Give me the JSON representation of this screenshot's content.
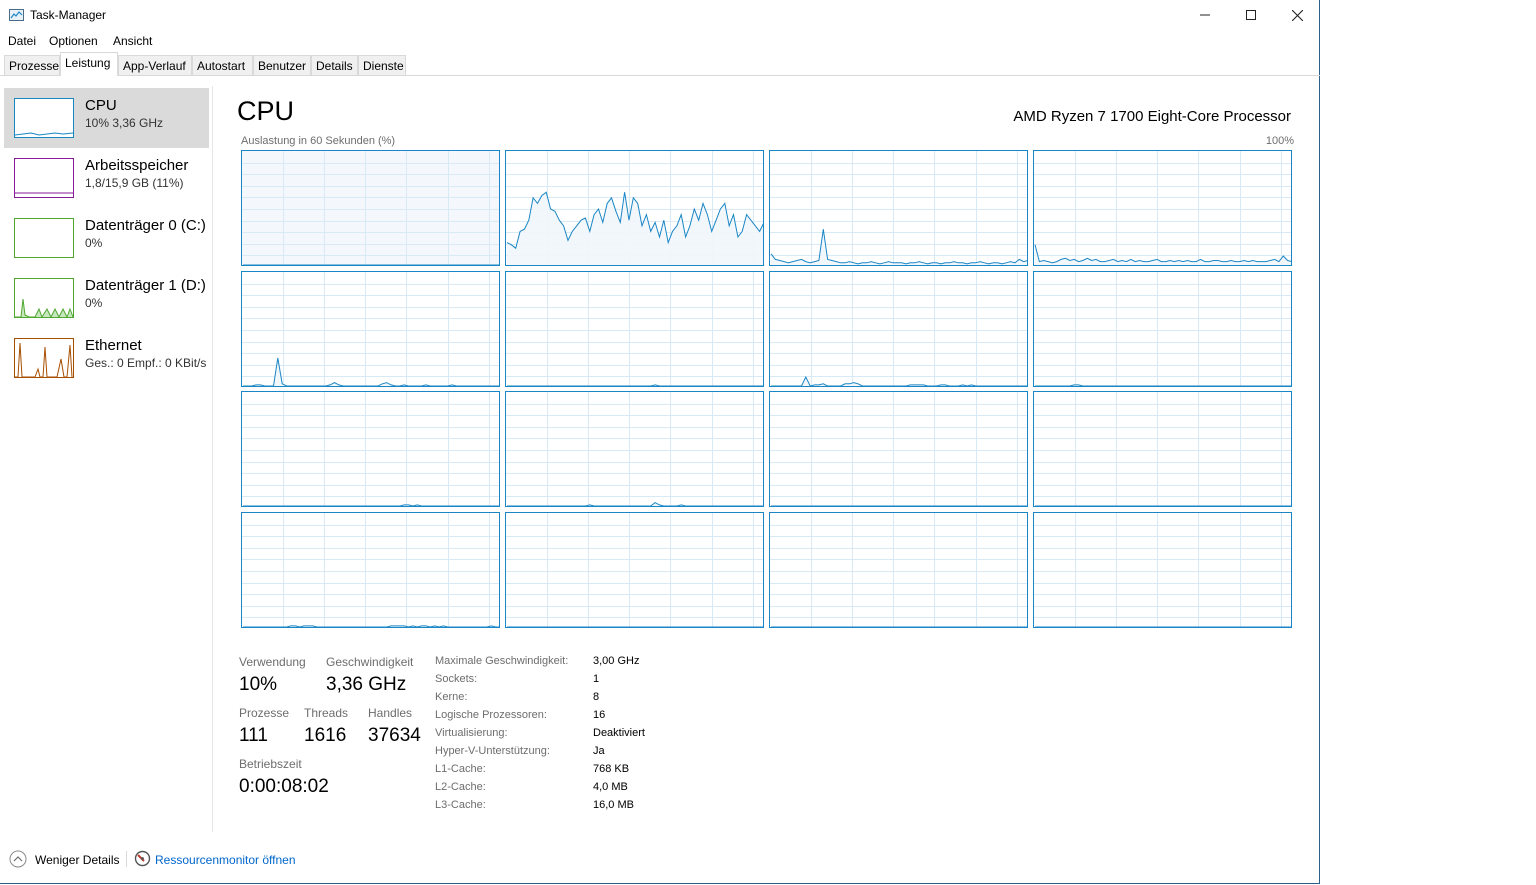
{
  "window": {
    "title": "Task-Manager",
    "controls": [
      "minimize",
      "maximize",
      "close"
    ]
  },
  "menu": [
    "Datei",
    "Optionen",
    "Ansicht"
  ],
  "tabs": [
    "Prozesse",
    "Leistung",
    "App-Verlauf",
    "Autostart",
    "Benutzer",
    "Details",
    "Dienste"
  ],
  "active_tab": "Leistung",
  "sidebar": [
    {
      "title": "CPU",
      "sub": "10%  3,36 GHz",
      "color": "#1a86c5"
    },
    {
      "title": "Arbeitsspeicher",
      "sub": "1,8/15,9 GB (11%)",
      "color": "#8b1a9b"
    },
    {
      "title": "Datenträger 0 (C:)",
      "sub": "0%",
      "color": "#4ea72e"
    },
    {
      "title": "Datenträger 1 (D:)",
      "sub": "0%",
      "color": "#4ea72e"
    },
    {
      "title": "Ethernet",
      "sub": "Ges.: 0  Empf.: 0 KBit/s",
      "color": "#a74f01"
    }
  ],
  "main": {
    "title": "CPU",
    "processor": "AMD Ryzen 7 1700 Eight-Core Processor",
    "graph_label": "Auslastung in 60 Sekunden (%)",
    "graph_max": "100%"
  },
  "stats": {
    "usage_label": "Verwendung",
    "usage": "10%",
    "speed_label": "Geschwindigkeit",
    "speed": "3,36 GHz",
    "processes_label": "Prozesse",
    "processes": "111",
    "threads_label": "Threads",
    "threads": "1616",
    "handles_label": "Handles",
    "handles": "37634",
    "uptime_label": "Betriebszeit",
    "uptime": "0:00:08:02"
  },
  "details": [
    {
      "key": "Maximale Geschwindigkeit:",
      "value": "3,00 GHz"
    },
    {
      "key": "Sockets:",
      "value": "1"
    },
    {
      "key": "Kerne:",
      "value": "8"
    },
    {
      "key": "Logische Prozessoren:",
      "value": "16"
    },
    {
      "key": "Virtualisierung:",
      "value": "Deaktiviert"
    },
    {
      "key": "Hyper-V-Unterstützung:",
      "value": "Ja"
    },
    {
      "key": "L1-Cache:",
      "value": "768 KB"
    },
    {
      "key": "L2-Cache:",
      "value": "4,0 MB"
    },
    {
      "key": "L3-Cache:",
      "value": "16,0 MB"
    }
  ],
  "footer": {
    "fewer_details": "Weniger Details",
    "resource_monitor": "Ressourcenmonitor öffnen"
  },
  "colors": {
    "cpu": "#1a86c5",
    "grid": "#d9eaf7",
    "fill": "#f1f6fb"
  },
  "cores": [
    [
      0,
      0,
      0,
      0,
      0,
      0,
      0,
      0,
      0,
      0,
      0,
      0,
      0,
      0,
      0,
      0,
      0,
      0,
      0,
      0,
      0,
      0,
      0,
      0,
      0,
      0,
      0,
      0,
      0,
      0,
      0,
      0,
      0,
      0,
      0,
      0,
      0,
      0,
      0,
      0,
      0,
      0,
      0,
      0,
      0,
      0,
      0,
      0,
      0,
      0,
      0,
      0,
      0,
      0,
      0,
      0,
      0,
      0,
      0,
      0
    ],
    [
      20,
      18,
      15,
      30,
      32,
      40,
      60,
      55,
      62,
      65,
      50,
      48,
      40,
      35,
      22,
      30,
      35,
      40,
      42,
      30,
      45,
      50,
      38,
      55,
      60,
      48,
      38,
      65,
      40,
      60,
      55,
      35,
      45,
      30,
      38,
      25,
      40,
      20,
      30,
      35,
      45,
      25,
      35,
      50,
      40,
      55,
      45,
      30,
      40,
      50,
      55,
      35,
      45,
      25,
      30,
      45,
      40,
      35,
      30,
      38
    ],
    [
      10,
      5,
      4,
      3,
      2,
      3,
      4,
      5,
      3,
      2,
      3,
      4,
      32,
      5,
      4,
      3,
      2,
      2,
      3,
      2,
      1,
      2,
      2,
      3,
      2,
      1,
      2,
      3,
      2,
      2,
      2,
      1,
      2,
      2,
      3,
      2,
      1,
      2,
      2,
      1,
      2,
      2,
      3,
      2,
      2,
      1,
      2,
      2,
      3,
      2,
      1,
      2,
      2,
      1,
      2,
      3,
      2,
      5,
      3,
      4
    ],
    [
      18,
      3,
      4,
      3,
      2,
      3,
      5,
      6,
      4,
      5,
      3,
      4,
      6,
      4,
      5,
      3,
      3,
      4,
      5,
      3,
      4,
      3,
      5,
      3,
      4,
      3,
      3,
      4,
      5,
      3,
      3,
      4,
      3,
      4,
      3,
      4,
      3,
      3,
      5,
      3,
      3,
      4,
      4,
      3,
      3,
      4,
      3,
      3,
      4,
      3,
      4,
      3,
      3,
      3,
      4,
      5,
      3,
      8,
      4,
      3
    ],
    [
      0,
      0,
      0,
      1,
      1,
      0,
      0,
      0,
      25,
      2,
      0,
      0,
      0,
      0,
      0,
      0,
      0,
      0,
      0,
      0,
      1,
      3,
      1,
      0,
      0,
      0,
      0,
      0,
      0,
      0,
      0,
      0,
      2,
      3,
      1,
      0,
      0,
      1,
      0,
      0,
      0,
      0,
      1,
      0,
      0,
      0,
      0,
      0,
      1,
      0,
      0,
      0,
      0,
      0,
      0,
      0,
      0,
      0,
      0,
      0
    ],
    [
      0,
      0,
      0,
      0,
      0,
      0,
      0,
      0,
      0,
      0,
      0,
      0,
      0,
      0,
      0,
      0,
      0,
      0,
      0,
      0,
      0,
      0,
      0,
      0,
      0,
      0,
      0,
      0,
      0,
      0,
      0,
      0,
      0,
      0,
      1,
      0,
      0,
      0,
      0,
      0,
      0,
      0,
      0,
      0,
      0,
      0,
      0,
      0,
      0,
      0,
      0,
      0,
      0,
      0,
      0,
      0,
      0,
      0,
      0,
      0
    ],
    [
      0,
      0,
      0,
      0,
      0,
      0,
      0,
      0,
      8,
      0,
      1,
      1,
      2,
      0,
      0,
      0,
      0,
      2,
      2,
      3,
      2,
      0,
      0,
      0,
      0,
      0,
      0,
      0,
      0,
      0,
      0,
      0,
      1,
      1,
      1,
      1,
      0,
      0,
      0,
      1,
      1,
      0,
      0,
      0,
      1,
      0,
      1,
      0,
      0,
      0,
      0,
      0,
      0,
      0,
      0,
      0,
      0,
      0,
      0,
      0
    ],
    [
      0,
      0,
      0,
      0,
      0,
      0,
      0,
      0,
      0,
      1,
      1,
      0,
      0,
      0,
      0,
      0,
      0,
      0,
      0,
      0,
      0,
      0,
      0,
      0,
      0,
      0,
      0,
      0,
      0,
      0,
      0,
      0,
      0,
      0,
      0,
      0,
      0,
      0,
      0,
      0,
      0,
      0,
      0,
      0,
      0,
      0,
      0,
      0,
      0,
      0,
      0,
      0,
      0,
      0,
      0,
      0,
      0,
      0,
      0,
      0
    ],
    [
      0,
      0,
      0,
      0,
      0,
      0,
      0,
      0,
      0,
      0,
      0,
      0,
      0,
      0,
      0,
      0,
      0,
      0,
      0,
      0,
      0,
      0,
      0,
      0,
      0,
      0,
      0,
      0,
      0,
      0,
      0,
      0,
      0,
      0,
      0,
      0,
      0,
      1,
      1,
      0,
      1,
      0,
      0,
      0,
      0,
      0,
      0,
      0,
      0,
      0,
      0,
      0,
      0,
      0,
      0,
      0,
      0,
      0,
      0,
      0
    ],
    [
      0,
      0,
      0,
      0,
      0,
      0,
      0,
      0,
      0,
      0,
      0,
      0,
      0,
      0,
      0,
      0,
      0,
      0,
      0,
      1,
      0,
      0,
      0,
      0,
      0,
      0,
      0,
      0,
      0,
      0,
      0,
      0,
      0,
      0,
      3,
      1,
      0,
      0,
      0,
      0,
      1,
      0,
      0,
      0,
      0,
      0,
      0,
      0,
      0,
      0,
      0,
      0,
      0,
      0,
      0,
      0,
      0,
      0,
      0,
      0
    ],
    [
      0,
      0,
      0,
      0,
      0,
      0,
      0,
      0,
      0,
      0,
      0,
      0,
      0,
      0,
      0,
      0,
      0,
      0,
      0,
      0,
      0,
      0,
      0,
      0,
      0,
      0,
      0,
      0,
      0,
      0,
      0,
      0,
      0,
      0,
      0,
      0,
      0,
      0,
      0,
      0,
      0,
      0,
      0,
      0,
      0,
      0,
      0,
      0,
      0,
      0,
      0,
      0,
      0,
      0,
      0,
      0,
      0,
      0,
      0,
      0
    ],
    [
      0,
      0,
      0,
      0,
      0,
      0,
      0,
      0,
      0,
      0,
      0,
      0,
      0,
      0,
      0,
      0,
      0,
      0,
      0,
      0,
      0,
      0,
      0,
      0,
      0,
      0,
      0,
      0,
      0,
      0,
      0,
      0,
      0,
      0,
      0,
      0,
      0,
      0,
      0,
      0,
      0,
      0,
      0,
      0,
      0,
      0,
      0,
      0,
      0,
      0,
      0,
      0,
      0,
      0,
      0,
      0,
      0,
      0,
      0,
      0
    ],
    [
      0,
      0,
      0,
      0,
      0,
      0,
      0,
      0,
      0,
      0,
      0,
      1,
      1,
      0,
      1,
      1,
      1,
      0,
      0,
      0,
      0,
      0,
      0,
      0,
      0,
      0,
      0,
      0,
      0,
      0,
      0,
      0,
      0,
      0,
      1,
      1,
      1,
      1,
      0,
      1,
      0,
      1,
      1,
      0,
      1,
      0,
      1,
      0,
      0,
      0,
      0,
      0,
      0,
      0,
      0,
      0,
      0,
      1,
      0,
      0
    ],
    [
      0,
      0,
      0,
      0,
      0,
      0,
      0,
      0,
      0,
      0,
      0,
      0,
      0,
      0,
      0,
      0,
      0,
      0,
      0,
      0,
      0,
      0,
      0,
      0,
      0,
      0,
      0,
      0,
      0,
      0,
      0,
      0,
      0,
      0,
      0,
      0,
      0,
      0,
      0,
      0,
      0,
      0,
      0,
      0,
      0,
      0,
      0,
      0,
      0,
      0,
      0,
      0,
      0,
      0,
      0,
      0,
      0,
      0,
      0,
      0
    ],
    [
      0,
      0,
      0,
      0,
      0,
      0,
      0,
      0,
      0,
      0,
      0,
      0,
      0,
      0,
      0,
      0,
      0,
      0,
      0,
      0,
      0,
      0,
      0,
      0,
      0,
      0,
      0,
      0,
      0,
      0,
      0,
      0,
      0,
      0,
      0,
      0,
      0,
      0,
      0,
      0,
      0,
      0,
      0,
      0,
      0,
      0,
      0,
      0,
      0,
      0,
      0,
      0,
      0,
      0,
      0,
      0,
      0,
      0,
      0,
      0
    ],
    [
      0,
      0,
      0,
      0,
      0,
      0,
      0,
      0,
      0,
      0,
      0,
      0,
      0,
      0,
      0,
      0,
      0,
      0,
      0,
      0,
      0,
      0,
      0,
      0,
      0,
      0,
      0,
      0,
      0,
      0,
      0,
      0,
      0,
      0,
      0,
      0,
      0,
      0,
      0,
      0,
      0,
      0,
      0,
      0,
      0,
      0,
      0,
      0,
      0,
      0,
      0,
      0,
      0,
      0,
      0,
      0,
      0,
      0,
      0,
      0
    ]
  ]
}
